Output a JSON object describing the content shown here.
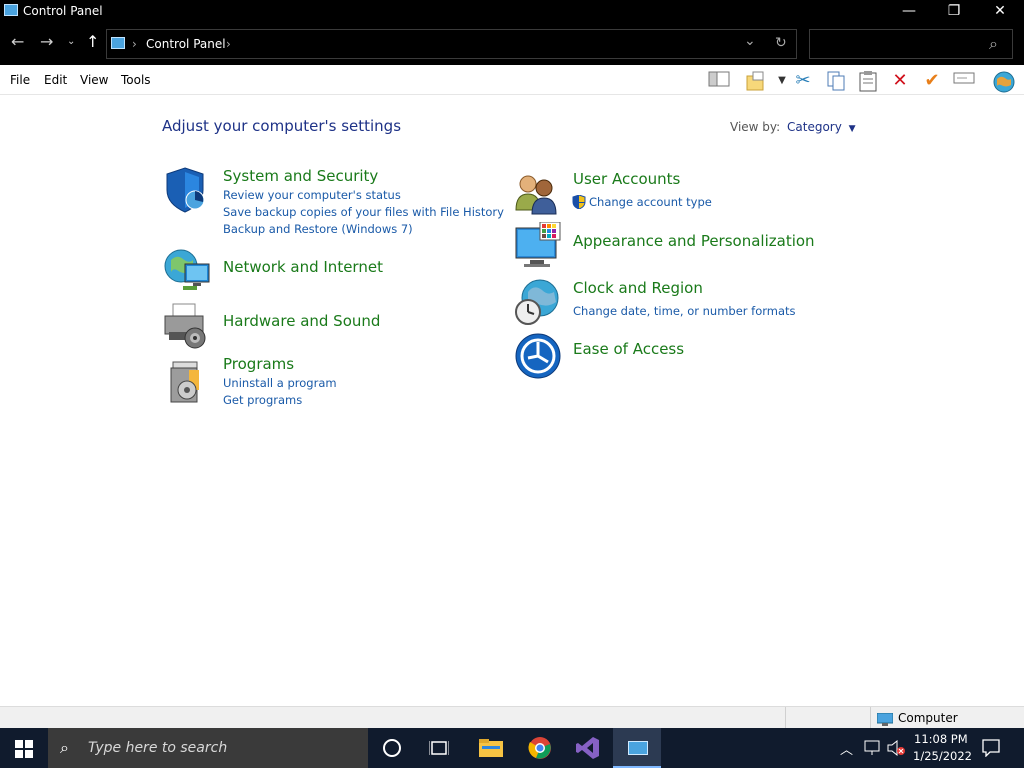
{
  "window": {
    "title": "Control Panel",
    "controls": {
      "minimize": "—",
      "maximize": "❐",
      "close": "✕"
    }
  },
  "address": {
    "crumbs": [
      "›",
      "Control Panel",
      "›"
    ],
    "refresh": "↻",
    "dropdown": "⌄"
  },
  "search": {
    "icon": "⌕"
  },
  "menu": [
    "File",
    "Edit",
    "View",
    "Tools"
  ],
  "content": {
    "heading": "Adjust your computer's settings",
    "view_by_label": "View by:",
    "view_by_value": "Category",
    "left": [
      {
        "title": "System and Security",
        "links": [
          "Review your computer's status",
          "Save backup copies of your files with File History",
          "Backup and Restore (Windows 7)"
        ]
      },
      {
        "title": "Network and Internet",
        "links": []
      },
      {
        "title": "Hardware and Sound",
        "links": []
      },
      {
        "title": "Programs",
        "links": [
          "Uninstall a program",
          "Get programs"
        ]
      }
    ],
    "right": [
      {
        "title": "User Accounts",
        "links": [
          "Change account type"
        ]
      },
      {
        "title": "Appearance and Personalization",
        "links": []
      },
      {
        "title": "Clock and Region",
        "links": [
          "Change date, time, or number formats"
        ]
      },
      {
        "title": "Ease of Access",
        "links": []
      }
    ]
  },
  "statusbar": {
    "location": "Computer"
  },
  "taskbar": {
    "search_placeholder": "Type here to search",
    "time": "11:08 PM",
    "date": "1/25/2022"
  },
  "colors": {
    "accent": "#1e3287",
    "category": "#1a7a1a",
    "link": "#1a5aa8",
    "taskbar": "#101b2d"
  }
}
